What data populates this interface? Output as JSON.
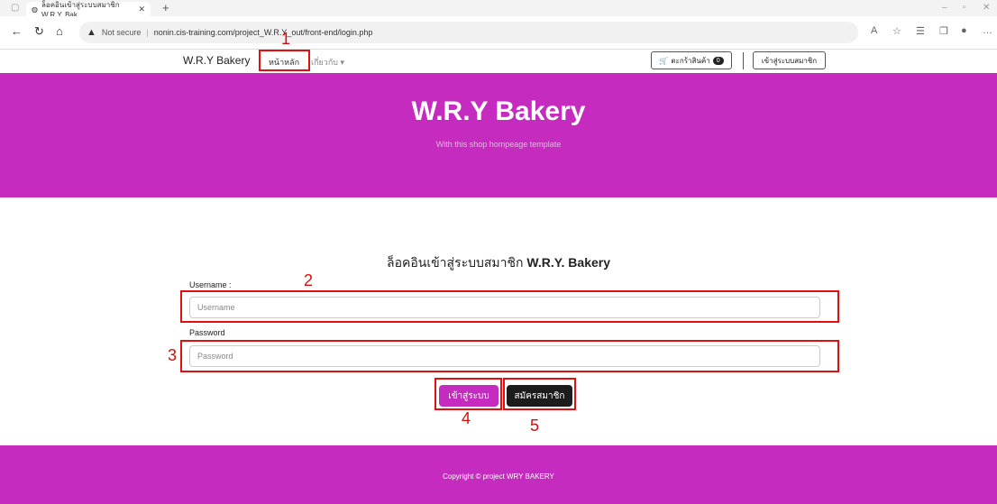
{
  "browser": {
    "tab_title": "ล็อคอินเข้าสู่ระบบสมาชิก W.R.Y. Bak",
    "new_tab": "+",
    "not_secure": "Not secure",
    "url": "nonin.cis-training.com/project_W.R.Y_out/front-end/login.php"
  },
  "navbar": {
    "brand": "W.R.Y Bakery",
    "home": "หน้าหลัก",
    "about": "เกี่ยวกับ ▾",
    "cart_label": "ตะกร้าสินค้า",
    "cart_count": "0",
    "login_button": "เข้าสู่ระบบสมาชิก"
  },
  "hero": {
    "title": "W.R.Y Bakery",
    "subtitle": "With this shop hompeage template"
  },
  "form": {
    "heading_thai": "ล็อคอินเข้าสู่ระบบสมาชิก",
    "heading_brand": "W.R.Y. Bakery",
    "username_label": "Username :",
    "username_placeholder": "Username",
    "password_label": "Password",
    "password_placeholder": "Password",
    "login_button": "เข้าสู่ระบบ",
    "register_button": "สมัครสมาชิก"
  },
  "annotations": {
    "n1": "1",
    "n2": "2",
    "n3": "3",
    "n4": "4",
    "n5": "5"
  },
  "footer": {
    "copyright": "Copyright © project WRY BAKERY"
  },
  "colors": {
    "brand": "#c52bbf",
    "annotation": "#e01010",
    "dark_button": "#1c1c1c"
  }
}
